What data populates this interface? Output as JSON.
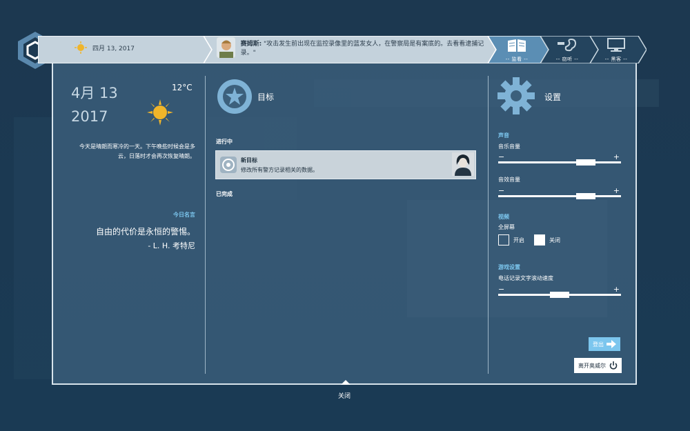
{
  "header": {
    "date": "四月 13, 2017",
    "news_speaker": "赛姆斯:",
    "news_text": "\"攻击发生前出现在监控录像里的蓝发女人，在警察局是有案底的。去看看逮捕记录。\"",
    "tabs": [
      {
        "label": "-- 监看 --",
        "icon": "book-icon",
        "active": true
      },
      {
        "label": "-- 窃听 --",
        "icon": "ear-icon",
        "active": false
      },
      {
        "label": "-- 黑客 --",
        "icon": "computer-icon",
        "active": false
      }
    ]
  },
  "today": {
    "month_day": "4月 13",
    "year": "2017",
    "temperature": "12°C",
    "weather_text": "今天是晴朗而寒冷的一天。下午晚些时候会是多云，日落时才会再次恢复晴朗。",
    "quote_heading": "今日名言",
    "quote": "自由的代价是永恒的警惕。",
    "quote_author": "- L. H. 考特尼"
  },
  "goals": {
    "title": "目标",
    "in_progress_label": "进行中",
    "completed_label": "已完成",
    "items": [
      {
        "title": "新目标",
        "description": "修改所有警方记录相关的数据。"
      }
    ]
  },
  "settings": {
    "title": "设置",
    "sound_heading": "声音",
    "music_label": "音乐音量",
    "music_level": 0.75,
    "sfx_label": "音效音量",
    "sfx_level": 0.75,
    "video_heading": "视频",
    "fullscreen_label": "全屏幕",
    "on_label": "开启",
    "off_label": "关闭",
    "fullscreen_on": false,
    "game_heading": "游戏设置",
    "scroll_label": "电话记录文字滚动速度",
    "scroll_level": 0.5,
    "minus": "−",
    "plus": "+",
    "logout_label": "登出",
    "leave_label": "离开奥威尔"
  },
  "close_label": "关闭",
  "colors": {
    "accent": "#7cc6ee",
    "panel": "#3c607c",
    "bar": "#c4d2dc"
  }
}
